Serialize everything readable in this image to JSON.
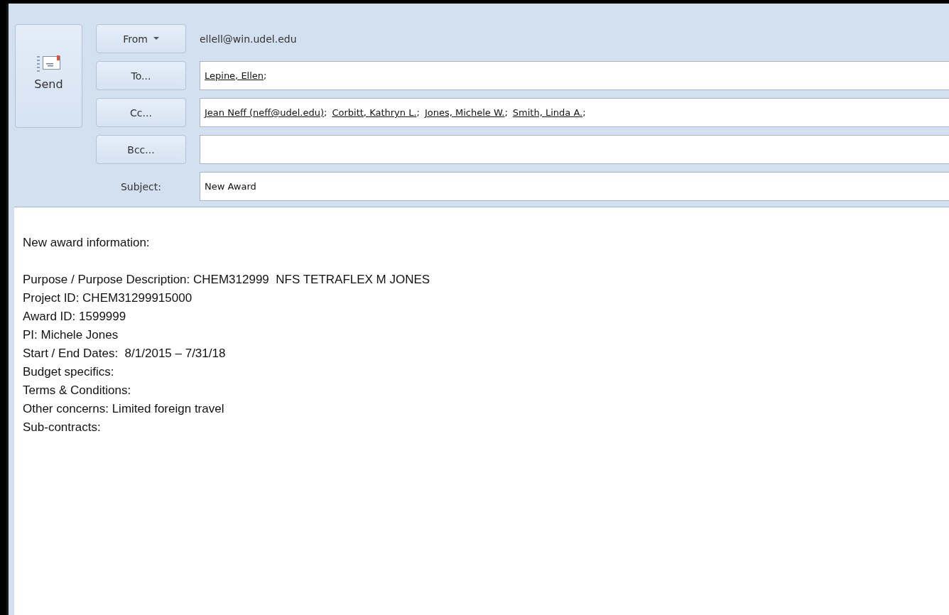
{
  "send_button": {
    "label": "Send"
  },
  "from": {
    "button": "From",
    "address": "ellell@win.udel.edu"
  },
  "to": {
    "button": "To...",
    "recipients": [
      {
        "name": "Lepine, Ellen",
        "separator": ";"
      }
    ]
  },
  "cc": {
    "button": "Cc...",
    "recipients": [
      {
        "name": "Jean Neff (neff@udel.edu)",
        "separator": ";"
      },
      {
        "name": "Corbitt, Kathryn L.",
        "separator": ";"
      },
      {
        "name": "Jones, Michele W.",
        "separator": ";"
      },
      {
        "name": "Smith, Linda A.",
        "separator": ";"
      }
    ]
  },
  "bcc": {
    "button": "Bcc..."
  },
  "subject": {
    "label": "Subject:",
    "value": "New Award"
  },
  "body": [
    [
      "New award information:"
    ],
    [
      "Purpose / Purpose Description: CHEM312999  NFS TETRAFLEX M JONES",
      "Project ID: CHEM31299915000",
      "Award ID: 1599999",
      "PI: Michele Jones",
      "Start / End Dates:  8/1/2015 – 7/31/18",
      "Budget specifics:",
      "Terms & Conditions:",
      "Other concerns: Limited foreign travel",
      "Sub-contracts:"
    ]
  ]
}
